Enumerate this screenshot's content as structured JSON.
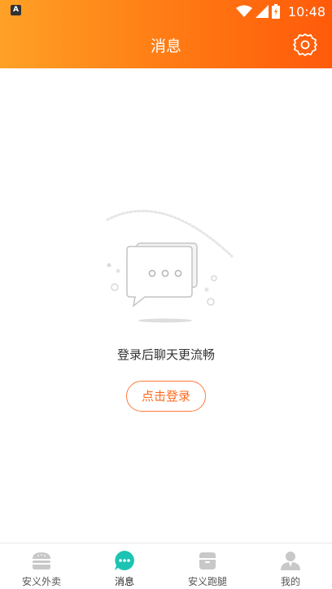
{
  "status_bar": {
    "time": "10:48",
    "app_badge": "A"
  },
  "header": {
    "title": "消息",
    "settings_icon": "gear-icon"
  },
  "empty_state": {
    "illustration_icon": "chat-bubble-icon",
    "message": "登录后聊天更流畅",
    "login_button": "点击登录"
  },
  "tabs": [
    {
      "label": "安义外卖",
      "icon": "burger-icon",
      "active": false
    },
    {
      "label": "消息",
      "icon": "message-icon",
      "active": true
    },
    {
      "label": "安义跑腿",
      "icon": "box-icon",
      "active": false
    },
    {
      "label": "我的",
      "icon": "user-icon",
      "active": false
    }
  ],
  "colors": {
    "header_start": "#ffa126",
    "header_end": "#ff5a0a",
    "accent": "#ff6a1f",
    "active_tab": "#1cc3b2",
    "inactive_tab": "#c8c8c8"
  }
}
